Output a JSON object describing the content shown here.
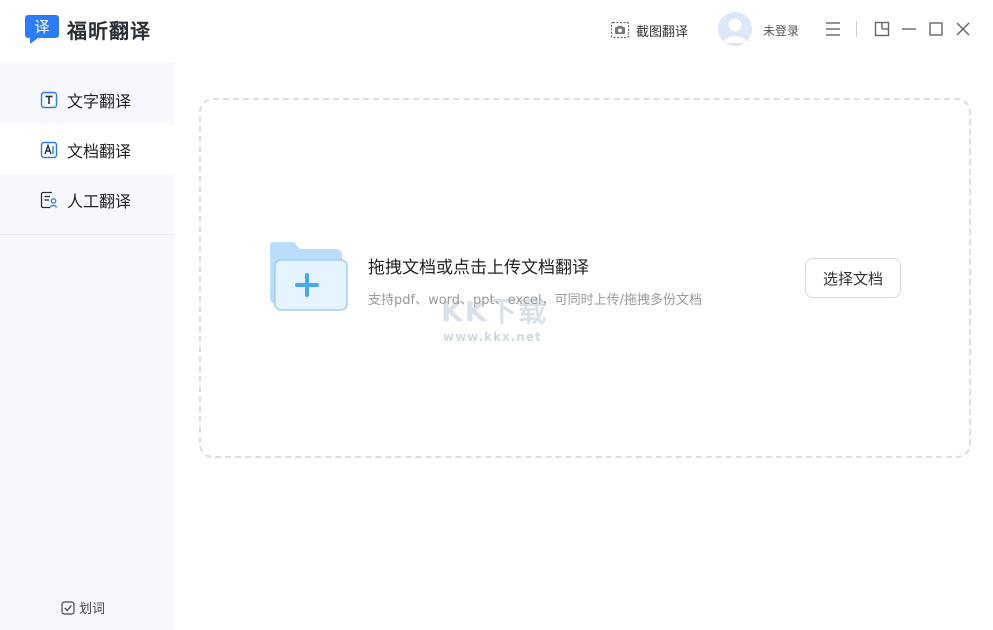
{
  "app": {
    "title": "福昕翻译",
    "logo_char": "译",
    "brand_color": "#2b7cf6"
  },
  "header": {
    "screenshot_label": "截图翻译",
    "login_label": "未登录"
  },
  "sidebar": {
    "items": [
      {
        "label": "文字翻译",
        "icon": "text-t-icon",
        "active": false
      },
      {
        "label": "文档翻译",
        "icon": "doc-a-icon",
        "active": true
      },
      {
        "label": "人工翻译",
        "icon": "human-translate-icon",
        "active": false
      }
    ],
    "huaci_label": "划词",
    "huaci_checked": true
  },
  "main": {
    "drop_title": "拖拽文档或点击上传文档翻译",
    "drop_subtitle": "支持pdf、word、ppt、excel，可同时上传/拖拽多份文档",
    "choose_button": "选择文档"
  },
  "watermark": {
    "big": "KK下载",
    "small": "www.kkx.net"
  }
}
